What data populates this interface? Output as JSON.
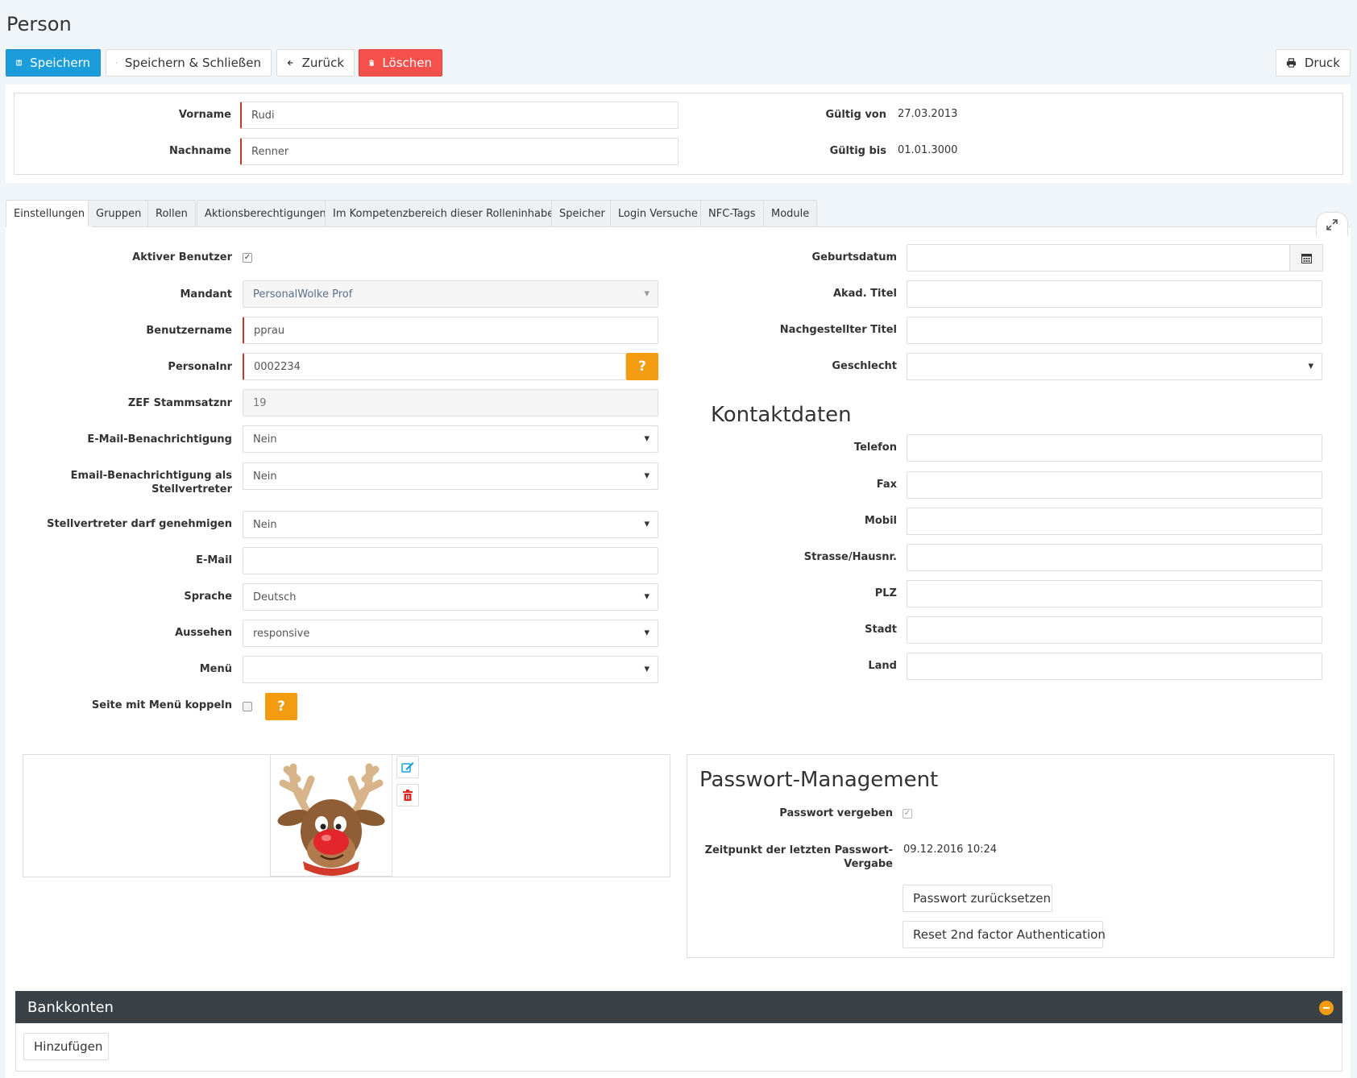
{
  "page": {
    "title": "Person"
  },
  "toolbar": {
    "save": "Speichern",
    "save_close": "Speichern & Schließen",
    "back": "Zurück",
    "delete": "Löschen",
    "print": "Druck"
  },
  "header_form": {
    "vorname": {
      "label": "Vorname",
      "value": "Rudi"
    },
    "nachname": {
      "label": "Nachname",
      "value": "Renner"
    },
    "gueltig_von": {
      "label": "Gültig von",
      "value": "27.03.2013"
    },
    "gueltig_bis": {
      "label": "Gültig bis",
      "value": "01.01.3000"
    }
  },
  "tabs": [
    {
      "label": "Einstellungen",
      "active": true
    },
    {
      "label": "Gruppen"
    },
    {
      "label": "Rollen"
    },
    {
      "label": "Aktionsberechtigungen"
    },
    {
      "label": "Im Kompetenzbereich dieser Rolleninhaber"
    },
    {
      "label": "Speicher"
    },
    {
      "label": "Login Versuche"
    },
    {
      "label": "NFC-Tags"
    },
    {
      "label": "Module"
    }
  ],
  "settings": {
    "aktiver_benutzer": {
      "label": "Aktiver Benutzer",
      "checked": true
    },
    "mandant": {
      "label": "Mandant",
      "value": "PersonalWolke Prof"
    },
    "benutzername": {
      "label": "Benutzername",
      "value": "pprau"
    },
    "personalnr": {
      "label": "Personalnr",
      "value": "0002234"
    },
    "zef": {
      "label": "ZEF Stammsatznr",
      "value": "19"
    },
    "email_benachrichtigung": {
      "label": "E-Mail-Benachrichtigung",
      "value": "Nein"
    },
    "email_stellvertreter": {
      "label_1": "Email-Benachrichtigung als",
      "label_2": "Stellvertreter",
      "value": "Nein"
    },
    "stellvertreter_genehmigen": {
      "label": "Stellvertreter darf genehmigen",
      "value": "Nein"
    },
    "email": {
      "label": "E-Mail",
      "value": ""
    },
    "sprache": {
      "label": "Sprache",
      "value": "Deutsch"
    },
    "aussehen": {
      "label": "Aussehen",
      "value": "responsive"
    },
    "menue": {
      "label": "Menü",
      "value": ""
    },
    "seite_koppeln": {
      "label": "Seite mit Menü koppeln",
      "checked": false
    },
    "help_glyph": "?"
  },
  "personal": {
    "geburtsdatum": {
      "label": "Geburtsdatum",
      "value": ""
    },
    "akad_titel": {
      "label": "Akad. Titel",
      "value": ""
    },
    "nachgestellter_titel": {
      "label": "Nachgestellter Titel",
      "value": ""
    },
    "geschlecht": {
      "label": "Geschlecht",
      "value": ""
    }
  },
  "kontakt": {
    "title": "Kontaktdaten",
    "telefon": {
      "label": "Telefon",
      "value": ""
    },
    "fax": {
      "label": "Fax",
      "value": ""
    },
    "mobil": {
      "label": "Mobil",
      "value": ""
    },
    "strasse": {
      "label": "Strasse/Hausnr.",
      "value": ""
    },
    "plz": {
      "label": "PLZ",
      "value": ""
    },
    "stadt": {
      "label": "Stadt",
      "value": ""
    },
    "land": {
      "label": "Land",
      "value": ""
    }
  },
  "passwort": {
    "title": "Passwort-Management",
    "vergeben": {
      "label": "Passwort vergeben",
      "checked": true
    },
    "zeitpunkt": {
      "label_1": "Zeitpunkt der letzten Passwort-",
      "label_2": "Vergabe",
      "value": "09.12.2016 10:24"
    },
    "reset_button": "Passwort zurücksetzen",
    "reset_2fa_button": "Reset 2nd factor Authentication"
  },
  "bankkonten": {
    "title": "Bankkonten",
    "add_button": "Hinzufügen"
  },
  "colors": {
    "primary": "#1b9ddb",
    "danger": "#f5504b",
    "warning": "#f39c12",
    "dark_header": "#3a4248",
    "required_border": "#c0392b"
  },
  "icons": [
    "save-icon",
    "archive-icon",
    "arrow-left-icon",
    "trash-icon",
    "print-icon",
    "expand-icon",
    "calendar-icon",
    "edit-icon",
    "collapse-icon",
    "reindeer-avatar"
  ]
}
